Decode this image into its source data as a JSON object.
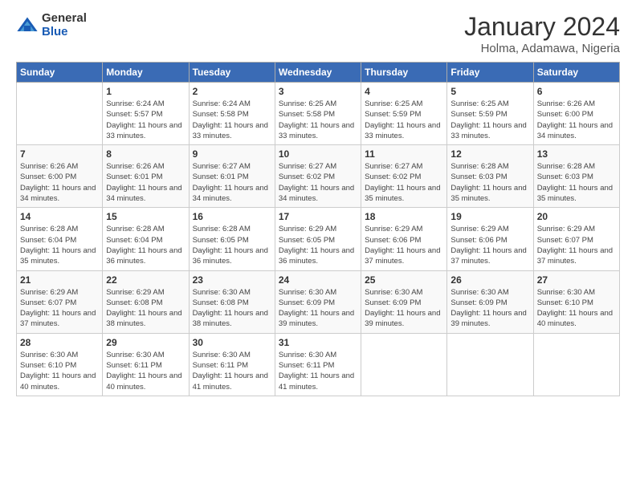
{
  "logo": {
    "general": "General",
    "blue": "Blue"
  },
  "title": "January 2024",
  "subtitle": "Holma, Adamawa, Nigeria",
  "headers": [
    "Sunday",
    "Monday",
    "Tuesday",
    "Wednesday",
    "Thursday",
    "Friday",
    "Saturday"
  ],
  "weeks": [
    [
      {
        "day": "",
        "sunrise": "",
        "sunset": "",
        "daylight": ""
      },
      {
        "day": "1",
        "sunrise": "Sunrise: 6:24 AM",
        "sunset": "Sunset: 5:57 PM",
        "daylight": "Daylight: 11 hours and 33 minutes."
      },
      {
        "day": "2",
        "sunrise": "Sunrise: 6:24 AM",
        "sunset": "Sunset: 5:58 PM",
        "daylight": "Daylight: 11 hours and 33 minutes."
      },
      {
        "day": "3",
        "sunrise": "Sunrise: 6:25 AM",
        "sunset": "Sunset: 5:58 PM",
        "daylight": "Daylight: 11 hours and 33 minutes."
      },
      {
        "day": "4",
        "sunrise": "Sunrise: 6:25 AM",
        "sunset": "Sunset: 5:59 PM",
        "daylight": "Daylight: 11 hours and 33 minutes."
      },
      {
        "day": "5",
        "sunrise": "Sunrise: 6:25 AM",
        "sunset": "Sunset: 5:59 PM",
        "daylight": "Daylight: 11 hours and 33 minutes."
      },
      {
        "day": "6",
        "sunrise": "Sunrise: 6:26 AM",
        "sunset": "Sunset: 6:00 PM",
        "daylight": "Daylight: 11 hours and 34 minutes."
      }
    ],
    [
      {
        "day": "7",
        "sunrise": "Sunrise: 6:26 AM",
        "sunset": "Sunset: 6:00 PM",
        "daylight": "Daylight: 11 hours and 34 minutes."
      },
      {
        "day": "8",
        "sunrise": "Sunrise: 6:26 AM",
        "sunset": "Sunset: 6:01 PM",
        "daylight": "Daylight: 11 hours and 34 minutes."
      },
      {
        "day": "9",
        "sunrise": "Sunrise: 6:27 AM",
        "sunset": "Sunset: 6:01 PM",
        "daylight": "Daylight: 11 hours and 34 minutes."
      },
      {
        "day": "10",
        "sunrise": "Sunrise: 6:27 AM",
        "sunset": "Sunset: 6:02 PM",
        "daylight": "Daylight: 11 hours and 34 minutes."
      },
      {
        "day": "11",
        "sunrise": "Sunrise: 6:27 AM",
        "sunset": "Sunset: 6:02 PM",
        "daylight": "Daylight: 11 hours and 35 minutes."
      },
      {
        "day": "12",
        "sunrise": "Sunrise: 6:28 AM",
        "sunset": "Sunset: 6:03 PM",
        "daylight": "Daylight: 11 hours and 35 minutes."
      },
      {
        "day": "13",
        "sunrise": "Sunrise: 6:28 AM",
        "sunset": "Sunset: 6:03 PM",
        "daylight": "Daylight: 11 hours and 35 minutes."
      }
    ],
    [
      {
        "day": "14",
        "sunrise": "Sunrise: 6:28 AM",
        "sunset": "Sunset: 6:04 PM",
        "daylight": "Daylight: 11 hours and 35 minutes."
      },
      {
        "day": "15",
        "sunrise": "Sunrise: 6:28 AM",
        "sunset": "Sunset: 6:04 PM",
        "daylight": "Daylight: 11 hours and 36 minutes."
      },
      {
        "day": "16",
        "sunrise": "Sunrise: 6:28 AM",
        "sunset": "Sunset: 6:05 PM",
        "daylight": "Daylight: 11 hours and 36 minutes."
      },
      {
        "day": "17",
        "sunrise": "Sunrise: 6:29 AM",
        "sunset": "Sunset: 6:05 PM",
        "daylight": "Daylight: 11 hours and 36 minutes."
      },
      {
        "day": "18",
        "sunrise": "Sunrise: 6:29 AM",
        "sunset": "Sunset: 6:06 PM",
        "daylight": "Daylight: 11 hours and 37 minutes."
      },
      {
        "day": "19",
        "sunrise": "Sunrise: 6:29 AM",
        "sunset": "Sunset: 6:06 PM",
        "daylight": "Daylight: 11 hours and 37 minutes."
      },
      {
        "day": "20",
        "sunrise": "Sunrise: 6:29 AM",
        "sunset": "Sunset: 6:07 PM",
        "daylight": "Daylight: 11 hours and 37 minutes."
      }
    ],
    [
      {
        "day": "21",
        "sunrise": "Sunrise: 6:29 AM",
        "sunset": "Sunset: 6:07 PM",
        "daylight": "Daylight: 11 hours and 37 minutes."
      },
      {
        "day": "22",
        "sunrise": "Sunrise: 6:29 AM",
        "sunset": "Sunset: 6:08 PM",
        "daylight": "Daylight: 11 hours and 38 minutes."
      },
      {
        "day": "23",
        "sunrise": "Sunrise: 6:30 AM",
        "sunset": "Sunset: 6:08 PM",
        "daylight": "Daylight: 11 hours and 38 minutes."
      },
      {
        "day": "24",
        "sunrise": "Sunrise: 6:30 AM",
        "sunset": "Sunset: 6:09 PM",
        "daylight": "Daylight: 11 hours and 39 minutes."
      },
      {
        "day": "25",
        "sunrise": "Sunrise: 6:30 AM",
        "sunset": "Sunset: 6:09 PM",
        "daylight": "Daylight: 11 hours and 39 minutes."
      },
      {
        "day": "26",
        "sunrise": "Sunrise: 6:30 AM",
        "sunset": "Sunset: 6:09 PM",
        "daylight": "Daylight: 11 hours and 39 minutes."
      },
      {
        "day": "27",
        "sunrise": "Sunrise: 6:30 AM",
        "sunset": "Sunset: 6:10 PM",
        "daylight": "Daylight: 11 hours and 40 minutes."
      }
    ],
    [
      {
        "day": "28",
        "sunrise": "Sunrise: 6:30 AM",
        "sunset": "Sunset: 6:10 PM",
        "daylight": "Daylight: 11 hours and 40 minutes."
      },
      {
        "day": "29",
        "sunrise": "Sunrise: 6:30 AM",
        "sunset": "Sunset: 6:11 PM",
        "daylight": "Daylight: 11 hours and 40 minutes."
      },
      {
        "day": "30",
        "sunrise": "Sunrise: 6:30 AM",
        "sunset": "Sunset: 6:11 PM",
        "daylight": "Daylight: 11 hours and 41 minutes."
      },
      {
        "day": "31",
        "sunrise": "Sunrise: 6:30 AM",
        "sunset": "Sunset: 6:11 PM",
        "daylight": "Daylight: 11 hours and 41 minutes."
      },
      {
        "day": "",
        "sunrise": "",
        "sunset": "",
        "daylight": ""
      },
      {
        "day": "",
        "sunrise": "",
        "sunset": "",
        "daylight": ""
      },
      {
        "day": "",
        "sunrise": "",
        "sunset": "",
        "daylight": ""
      }
    ]
  ]
}
